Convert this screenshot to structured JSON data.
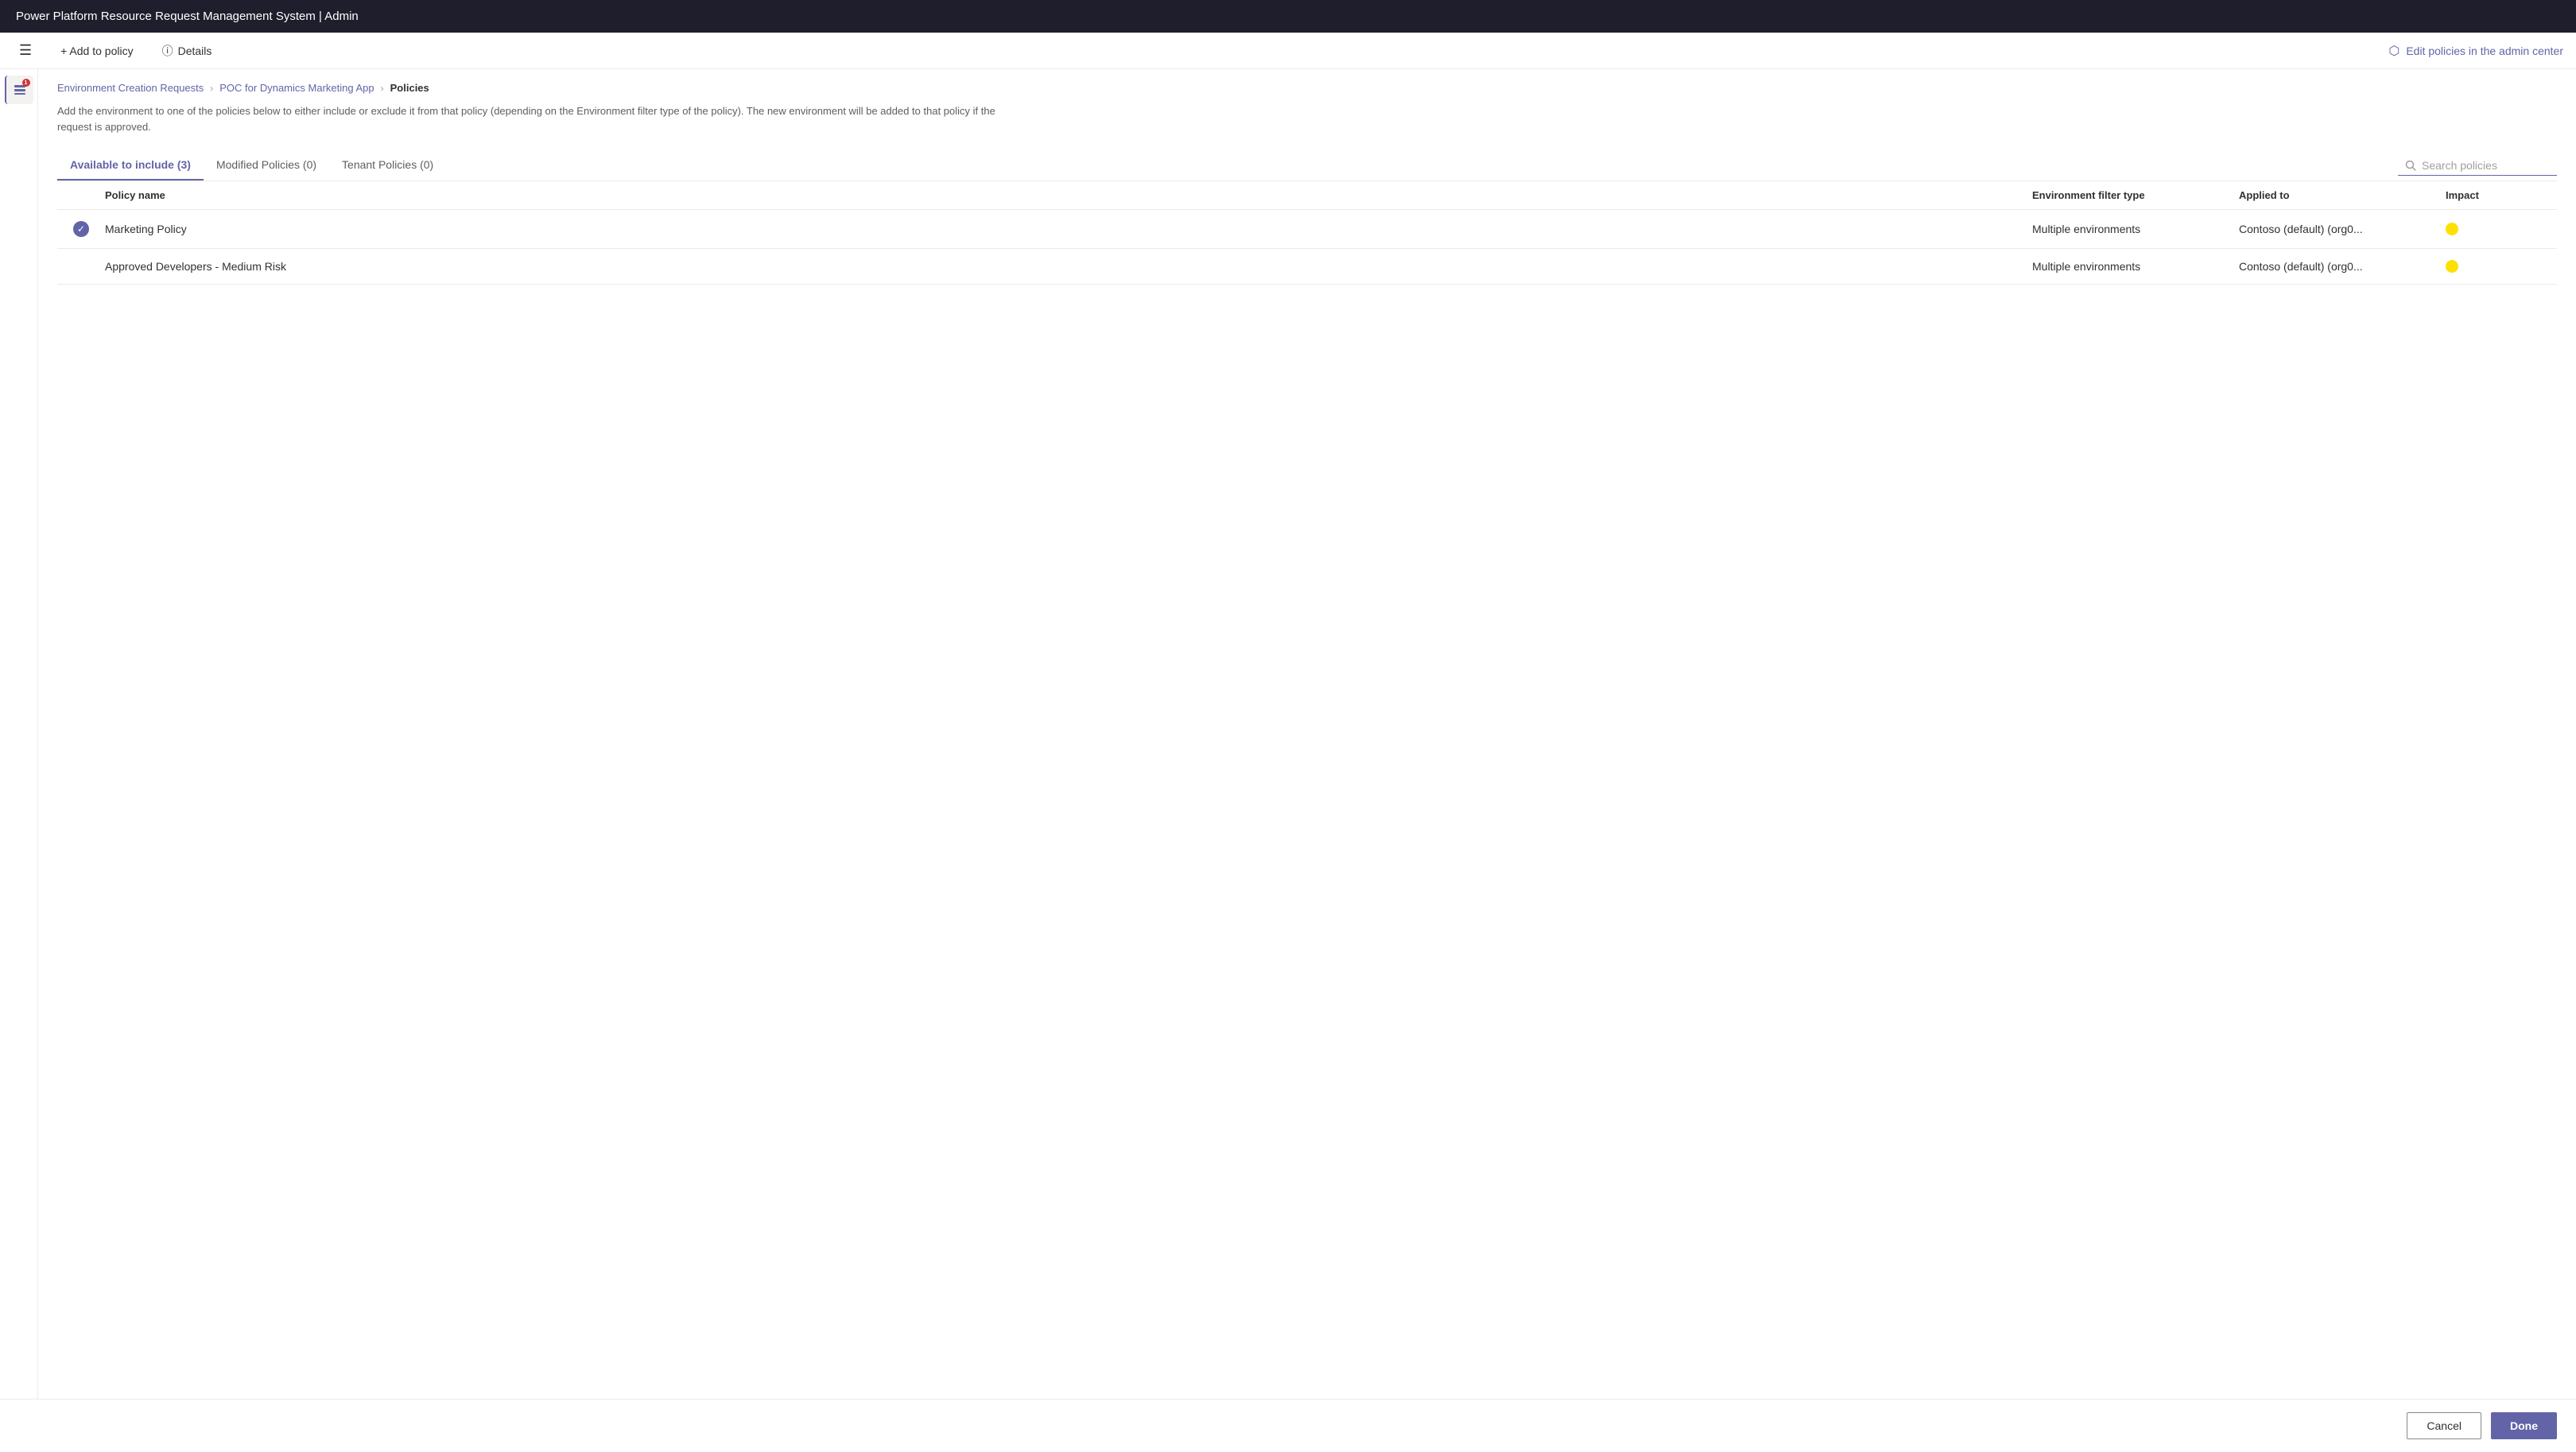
{
  "titleBar": {
    "title": "Power Platform Resource Request Management System | Admin"
  },
  "toolbar": {
    "menuIcon": "☰",
    "addToPolicyLabel": "+ Add to policy",
    "detailsIcon": "ⓘ",
    "detailsLabel": "Details",
    "editPoliciesIcon": "↗",
    "editPoliciesLabel": "Edit policies in the admin center"
  },
  "sidebar": {
    "homeIcon": "🏠",
    "notificationBadge": "1"
  },
  "breadcrumb": {
    "items": [
      {
        "label": "Environment Creation Requests",
        "active": false
      },
      {
        "label": "POC for Dynamics Marketing App",
        "active": false
      },
      {
        "label": "Policies",
        "active": true
      }
    ],
    "separator": "›"
  },
  "description": "Add the environment to one of the policies below to either include or exclude it from that policy (depending on the Environment filter type of the policy). The new environment will be added to that policy if the request is approved.",
  "tabs": [
    {
      "label": "Available to include (3)",
      "active": true
    },
    {
      "label": "Modified Policies (0)",
      "active": false
    },
    {
      "label": "Tenant Policies (0)",
      "active": false
    }
  ],
  "search": {
    "placeholder": "Search policies"
  },
  "tableHeaders": {
    "policyName": "Policy name",
    "filterType": "Environment filter type",
    "appliedTo": "Applied to",
    "impact": "Impact"
  },
  "tableRows": [
    {
      "selected": true,
      "policyName": "Marketing Policy",
      "filterType": "Multiple environments",
      "appliedTo": "Contoso (default) (org0...",
      "impactColor": "#fce100"
    },
    {
      "selected": false,
      "policyName": "Approved Developers - Medium Risk",
      "filterType": "Multiple environments",
      "appliedTo": "Contoso (default) (org0...",
      "impactColor": "#fce100"
    }
  ],
  "footer": {
    "cancelLabel": "Cancel",
    "doneLabel": "Done"
  }
}
